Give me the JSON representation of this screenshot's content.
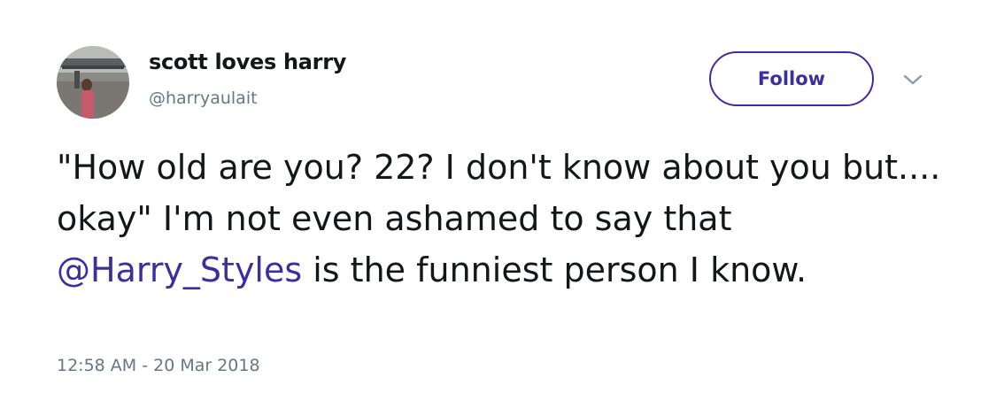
{
  "user": {
    "display_name": "scott loves harry",
    "handle": "@harryaulait"
  },
  "actions": {
    "follow_label": "Follow",
    "more_icon": "chevron-down-icon"
  },
  "tweet": {
    "text_part1": "\"How old are you? 22? I don't know about you but.... okay\" I'm not even ashamed to say that ",
    "mention": "@Harry_Styles",
    "text_part2": " is the funniest person I know.",
    "timestamp": "12:58 AM - 20 Mar 2018"
  },
  "colors": {
    "accent": "#3b2fa0",
    "text": "#14171a",
    "muted": "#657786"
  }
}
